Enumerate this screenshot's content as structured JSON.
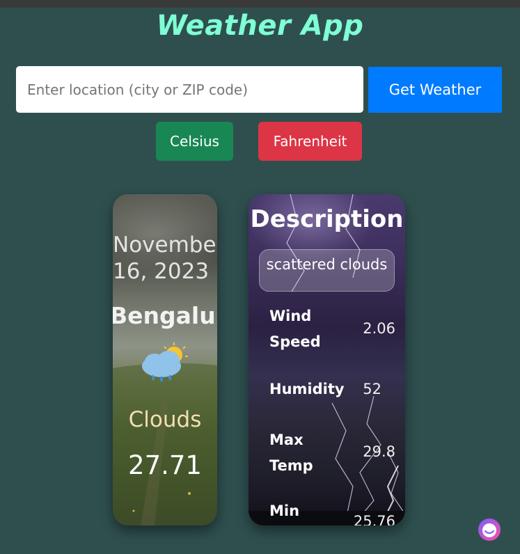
{
  "app": {
    "title": "Weather App"
  },
  "search": {
    "placeholder": "Enter location (city or ZIP code)",
    "value": ""
  },
  "buttons": {
    "get_weather": "Get Weather",
    "celsius": "Celsius",
    "fahrenheit": "Fahrenheit"
  },
  "colors": {
    "background": "#2f4f4f",
    "title": "#7fffd4",
    "get_weather": "#007bff",
    "celsius": "#198754",
    "fahrenheit": "#dc3545"
  },
  "weather_card": {
    "date_line1": "November",
    "date_line2": "16, 2023",
    "city": "Bengaluru",
    "icon": "rain-cloud-sun-icon",
    "condition": "Clouds",
    "temperature": "27.71"
  },
  "details_card": {
    "title": "Description",
    "description": "scattered clouds",
    "stats": [
      {
        "label_line1": "Wind",
        "label_line2": "Speed",
        "value": "2.06"
      },
      {
        "label_line1": "Humidity",
        "label_line2": "",
        "value": "52"
      },
      {
        "label_line1": "Max",
        "label_line2": "Temp",
        "value": "29.8"
      },
      {
        "label_line1": "Min",
        "label_line2": "",
        "value": "25.76"
      }
    ]
  },
  "assistant": {
    "icon": "assistant-bot-icon"
  }
}
